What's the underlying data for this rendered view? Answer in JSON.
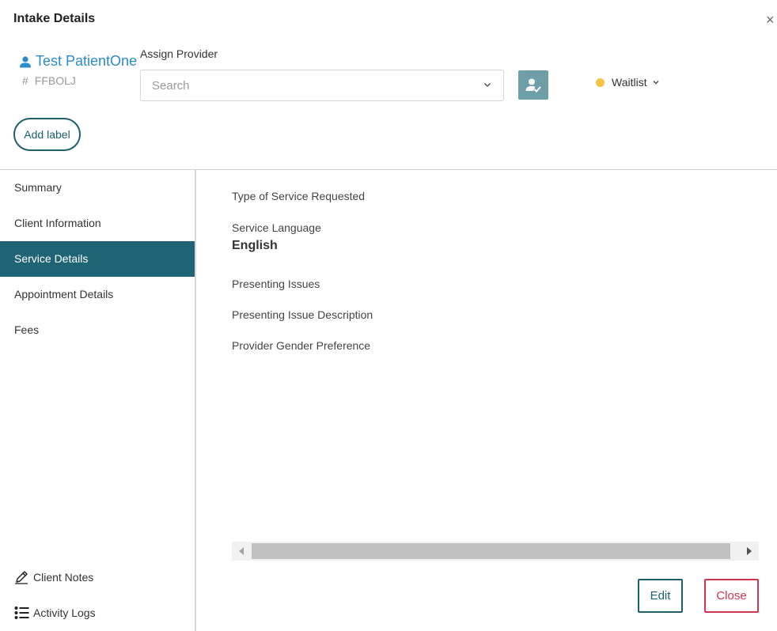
{
  "modal": {
    "title": "Intake Details",
    "close_glyph": "×"
  },
  "patient": {
    "name": "Test PatientOne",
    "id_prefix": "#",
    "id": "FFBOLJ",
    "icon": "user-icon"
  },
  "assign": {
    "label": "Assign Provider",
    "placeholder": "Search",
    "value": "",
    "button_icon": "user-check-icon"
  },
  "status": {
    "label": "Waitlist",
    "dot_color": "#f5c242"
  },
  "labels": {
    "add_label": "Add label"
  },
  "sidebar": {
    "items": [
      {
        "label": "Summary",
        "active": false
      },
      {
        "label": "Client Information",
        "active": false
      },
      {
        "label": "Service Details",
        "active": true
      },
      {
        "label": "Appointment Details",
        "active": false
      },
      {
        "label": "Fees",
        "active": false
      }
    ],
    "footer": [
      {
        "label": "Client Notes",
        "icon": "pen-icon"
      },
      {
        "label": "Activity Logs",
        "icon": "list-icon"
      }
    ]
  },
  "service_details": {
    "type_of_service_label": "Type of Service Requested",
    "service_language_label": "Service Language",
    "service_language_value": "English",
    "presenting_issues_label": "Presenting Issues",
    "presenting_issue_description_label": "Presenting Issue Description",
    "provider_gender_preference_label": "Provider Gender Preference"
  },
  "actions": {
    "edit": "Edit",
    "close": "Close"
  },
  "colors": {
    "accent": "#1e6474",
    "link": "#2b8bc9",
    "danger": "#d0374f"
  }
}
